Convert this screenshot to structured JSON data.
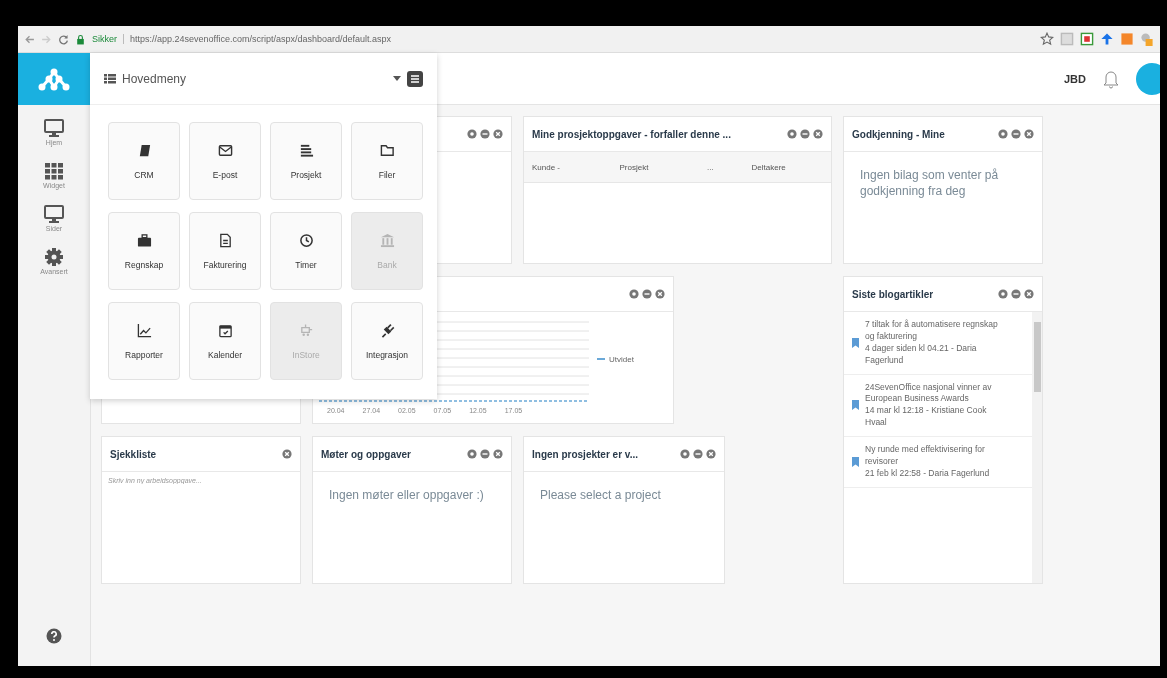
{
  "browser": {
    "secure_label": "Sikker",
    "url": "https://app.24sevenoffice.com/script/aspx/dashboard/default.aspx"
  },
  "header": {
    "user_initials": "JBD"
  },
  "sidebar": {
    "items": [
      {
        "label": "Hjem"
      },
      {
        "label": "Widget"
      },
      {
        "label": "Sider"
      },
      {
        "label": "Avansert"
      }
    ]
  },
  "menu": {
    "title": "Hovedmeny",
    "tiles": [
      {
        "label": "CRM",
        "disabled": false
      },
      {
        "label": "E-post",
        "disabled": false
      },
      {
        "label": "Prosjekt",
        "disabled": false
      },
      {
        "label": "Filer",
        "disabled": false
      },
      {
        "label": "Regnskap",
        "disabled": false
      },
      {
        "label": "Fakturering",
        "disabled": false
      },
      {
        "label": "Timer",
        "disabled": false
      },
      {
        "label": "Bank",
        "disabled": true
      },
      {
        "label": "Rapporter",
        "disabled": false
      },
      {
        "label": "Kalender",
        "disabled": false
      },
      {
        "label": "InStore",
        "disabled": true
      },
      {
        "label": "Integrasjon",
        "disabled": false
      }
    ]
  },
  "project_tasks": {
    "title": "Mine prosjektoppgaver - forfaller denne ...",
    "columns": [
      "Kunde -",
      "Prosjekt",
      "...",
      "Deltakere"
    ]
  },
  "approval": {
    "title": "Godkjenning - Mine",
    "message": "Ingen bilag som venter på godkjenning fra deg"
  },
  "chart_widget": {
    "legend": "Utvidet",
    "x_labels": [
      "20.04",
      "27.04",
      "02.05",
      "07.05",
      "12.05",
      "17.05"
    ]
  },
  "blog": {
    "title": "Siste blogartikler",
    "articles": [
      {
        "title": "7 tiltak for å automatisere regnskap og fakturering",
        "meta": "4 dager siden kl 04.21 - Daria Fagerlund"
      },
      {
        "title": "24SevenOffice nasjonal vinner av European Business Awards",
        "meta": "14 mar kl 12:18 - Kristiane Cook Hvaal"
      },
      {
        "title": "Ny runde med effektivisering for revisorer",
        "meta": "21 feb kl 22:58 - Daria Fagerlund"
      }
    ]
  },
  "checklist": {
    "title": "Sjekkliste",
    "placeholder": "Skriv inn ny arbeidsoppgave..."
  },
  "meetings": {
    "title": "Møter og oppgaver",
    "message": "Ingen møter eller oppgaver :)"
  },
  "projects": {
    "title": "Ingen prosjekter er v...",
    "message": "Please select a project"
  }
}
